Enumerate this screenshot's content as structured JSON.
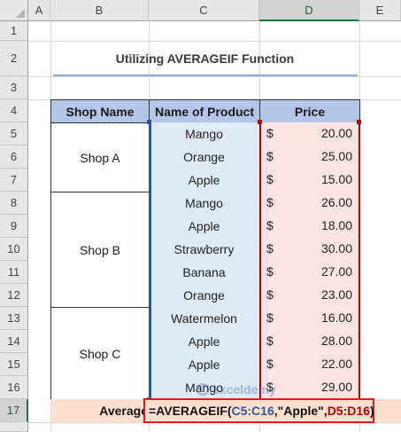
{
  "columns": [
    "A",
    "B",
    "C",
    "D",
    "E"
  ],
  "selected_column": "D",
  "rows": [
    "1",
    "2",
    "3",
    "4",
    "5",
    "6",
    "7",
    "8",
    "9",
    "10",
    "11",
    "12",
    "13",
    "14",
    "15",
    "16",
    "17"
  ],
  "selected_row": "17",
  "title": "Utilizing AVERAGEIF Function",
  "headers": {
    "shop": "Shop Name",
    "product": "Name of Product",
    "price": "Price"
  },
  "shops": [
    "Shop A",
    "Shop B",
    "Shop C"
  ],
  "items": [
    {
      "product": "Mango",
      "currency": "$",
      "price": "20.00"
    },
    {
      "product": "Orange",
      "currency": "$",
      "price": "25.00"
    },
    {
      "product": "Apple",
      "currency": "$",
      "price": "15.00"
    },
    {
      "product": "Mango",
      "currency": "$",
      "price": "26.00"
    },
    {
      "product": "Apple",
      "currency": "$",
      "price": "18.00"
    },
    {
      "product": "Strawberry",
      "currency": "$",
      "price": "30.00"
    },
    {
      "product": "Banana",
      "currency": "$",
      "price": "27.00"
    },
    {
      "product": "Orange",
      "currency": "$",
      "price": "23.00"
    },
    {
      "product": "Watermelon",
      "currency": "$",
      "price": "16.00"
    },
    {
      "product": "Apple",
      "currency": "$",
      "price": "28.00"
    },
    {
      "product": "Apple",
      "currency": "$",
      "price": "22.00"
    },
    {
      "product": "Mango",
      "currency": "$",
      "price": "29.00"
    }
  ],
  "average_label": "Average",
  "formula": {
    "prefix": "=AVERAGEIF(",
    "range1": "C5:C16",
    "sep1": ",\"Apple\",",
    "range2": "D5:D16",
    "suffix": ")"
  },
  "watermark": "exceldemy",
  "colors": {
    "header_fill": "#b4c6e7",
    "product_fill": "#ddebf7",
    "price_fill": "#fce4e4",
    "avg_fill": "#fbe0cf",
    "formula_border": "#e31b1b",
    "ref1": "#2f5597",
    "ref2": "#c00000"
  }
}
